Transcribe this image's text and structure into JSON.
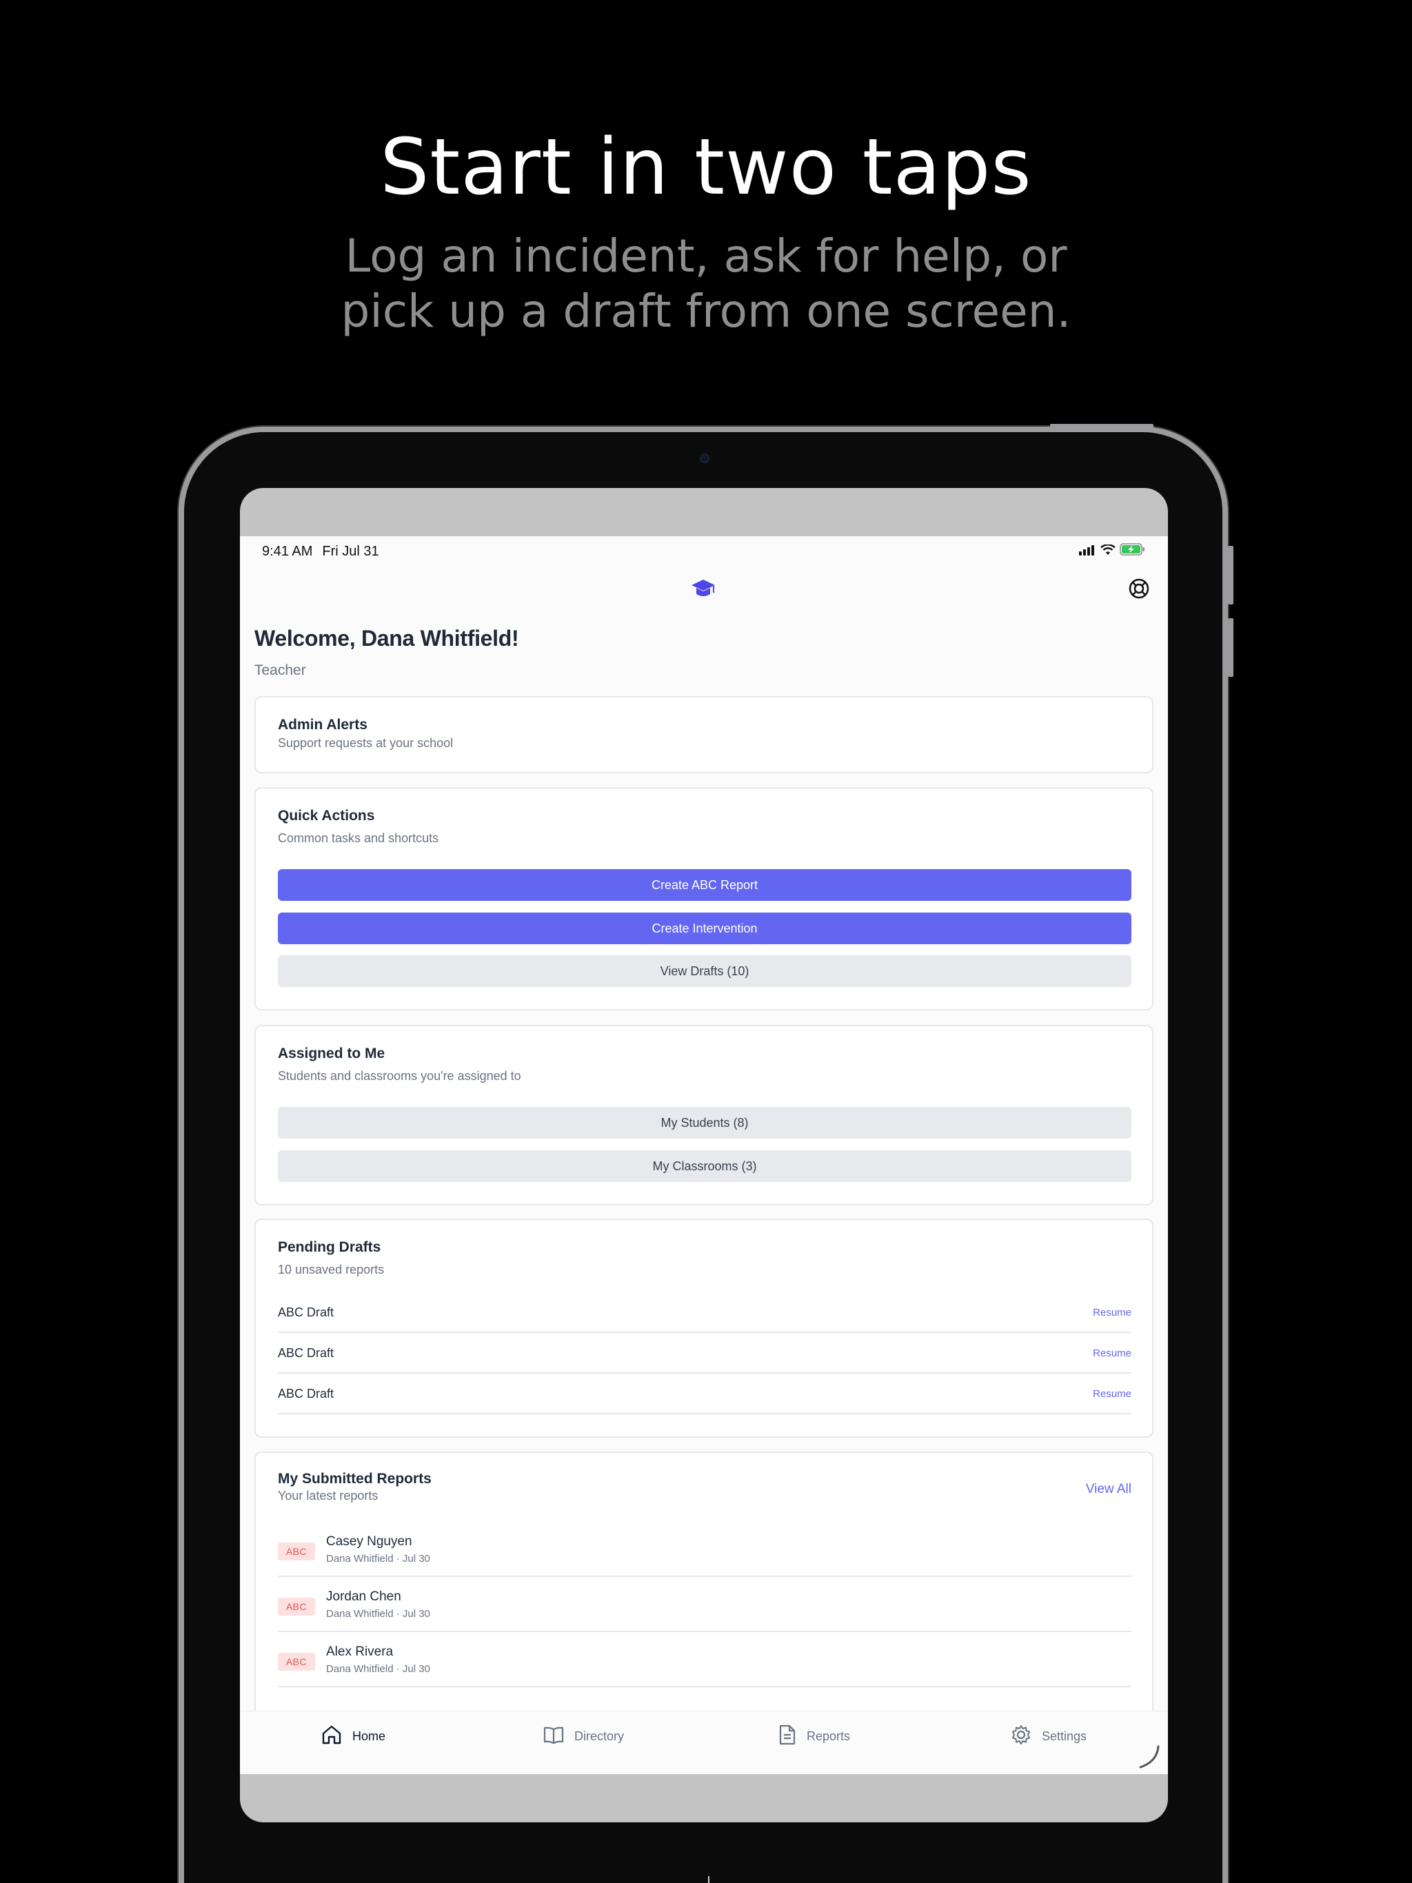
{
  "promo": {
    "title": "Start in two taps",
    "subtitle_line1": "Log an incident, ask for help, or",
    "subtitle_line2": "pick up a draft from one screen."
  },
  "status_bar": {
    "time": "9:41 AM",
    "date": "Fri Jul 31"
  },
  "header": {
    "logo_icon": "graduation-cap-icon",
    "help_icon": "lifebuoy-icon"
  },
  "welcome": {
    "greeting": "Welcome, Dana Whitfield!",
    "role": "Teacher"
  },
  "admin_alerts": {
    "title": "Admin Alerts",
    "subtitle": "Support requests at your school"
  },
  "quick_actions": {
    "title": "Quick Actions",
    "subtitle": "Common tasks and shortcuts",
    "create_abc": "Create ABC Report",
    "create_intervention": "Create Intervention",
    "view_drafts": "View Drafts (10)"
  },
  "assigned": {
    "title": "Assigned to Me",
    "subtitle": "Students and classrooms you're assigned to",
    "my_students": "My Students (8)",
    "my_classrooms": "My Classrooms (3)"
  },
  "pending_drafts": {
    "title": "Pending Drafts",
    "subtitle": "10 unsaved reports",
    "items": [
      {
        "name": "ABC Draft",
        "action": "Resume"
      },
      {
        "name": "ABC Draft",
        "action": "Resume"
      },
      {
        "name": "ABC Draft",
        "action": "Resume"
      }
    ]
  },
  "submitted_reports": {
    "title": "My Submitted Reports",
    "subtitle": "Your latest reports",
    "view_all": "View All",
    "items": [
      {
        "badge": "ABC",
        "student": "Casey Nguyen",
        "meta": "Dana Whitfield · Jul 30"
      },
      {
        "badge": "ABC",
        "student": "Jordan Chen",
        "meta": "Dana Whitfield · Jul 30"
      },
      {
        "badge": "ABC",
        "student": "Alex Rivera",
        "meta": "Dana Whitfield · Jul 30"
      }
    ]
  },
  "tabs": [
    {
      "label": "Home",
      "icon": "home-icon"
    },
    {
      "label": "Directory",
      "icon": "book-icon"
    },
    {
      "label": "Reports",
      "icon": "document-icon"
    },
    {
      "label": "Settings",
      "icon": "gear-icon"
    }
  ],
  "colors": {
    "accent": "#6366f1",
    "badge_bg": "#fde0e0",
    "badge_text": "#e05555"
  }
}
